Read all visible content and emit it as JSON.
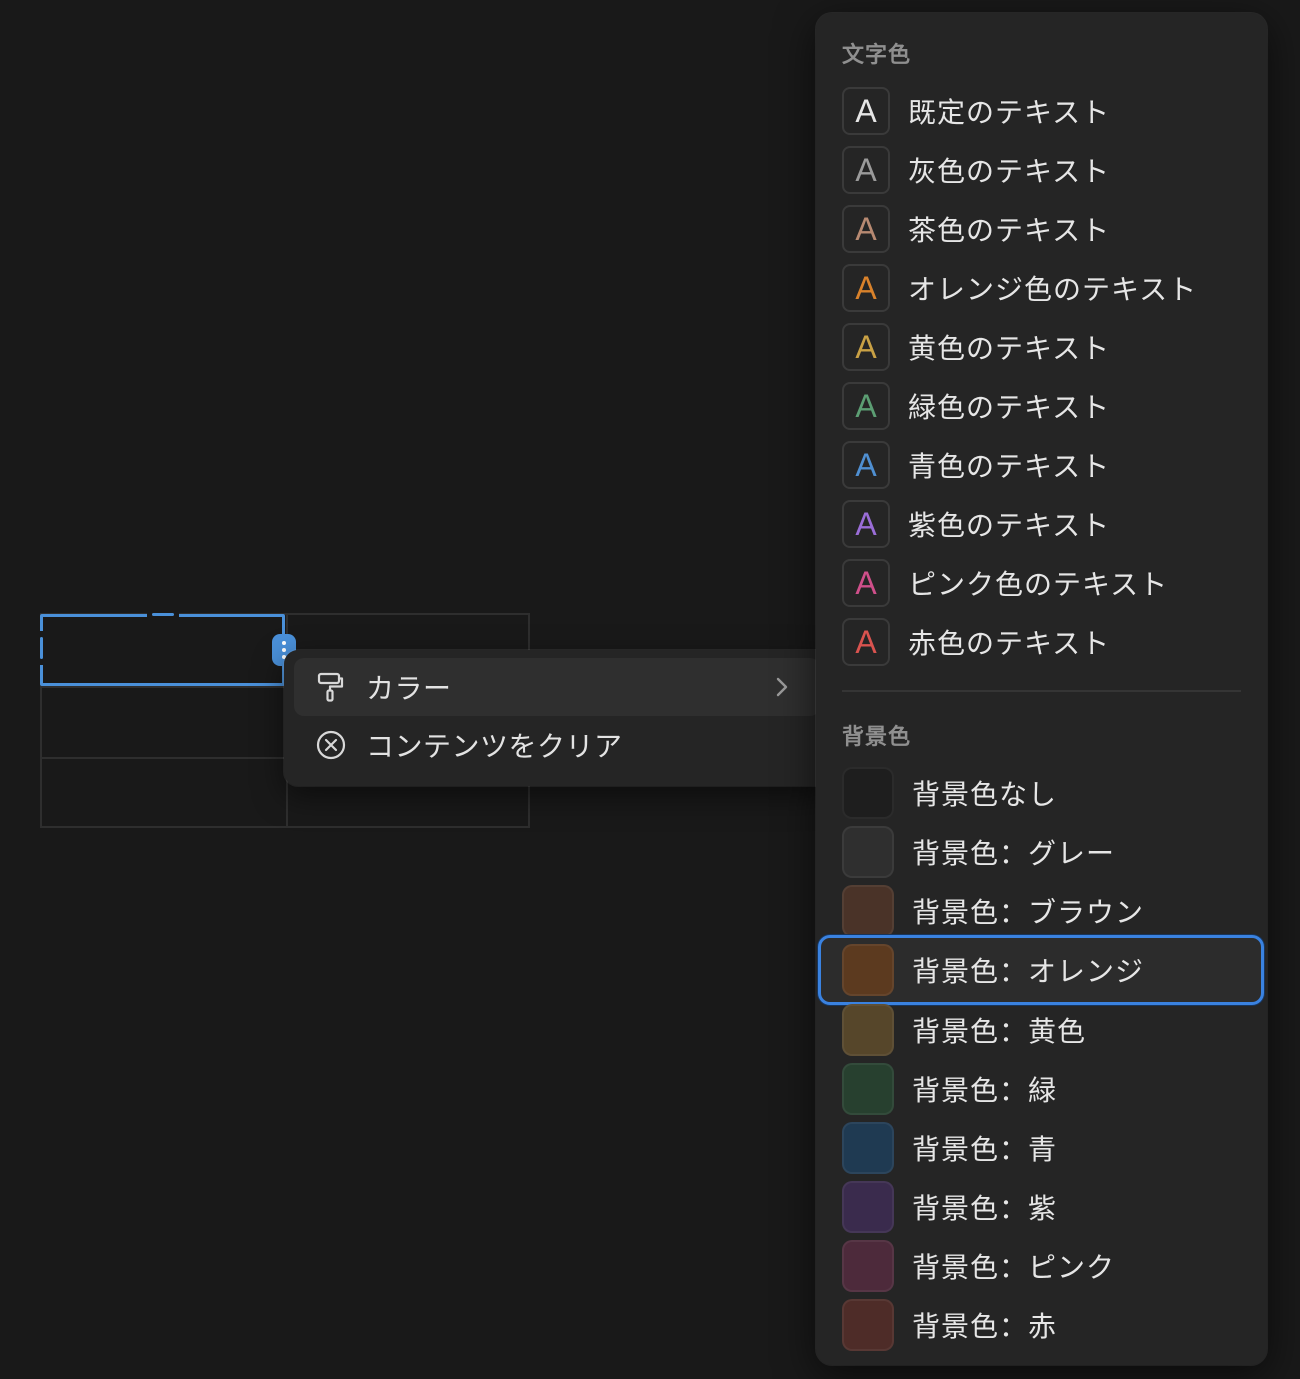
{
  "context_menu": {
    "items": [
      {
        "label": "カラー",
        "icon": "paint-roller-icon",
        "has_submenu": true
      },
      {
        "label": "コンテンツをクリア",
        "icon": "clear-circle-x-icon",
        "has_submenu": false
      }
    ]
  },
  "color_panel": {
    "text_section_title": "文字色",
    "text_colors": [
      {
        "letter": "A",
        "label": "既定のテキスト",
        "color": "#e6e6e6"
      },
      {
        "letter": "A",
        "label": "灰色のテキスト",
        "color": "#9b9b9b"
      },
      {
        "letter": "A",
        "label": "茶色のテキスト",
        "color": "#b88a72"
      },
      {
        "letter": "A",
        "label": "オレンジ色のテキスト",
        "color": "#d9822b"
      },
      {
        "letter": "A",
        "label": "黄色のテキスト",
        "color": "#c9a145"
      },
      {
        "letter": "A",
        "label": "緑色のテキスト",
        "color": "#5c9e73"
      },
      {
        "letter": "A",
        "label": "青色のテキスト",
        "color": "#4f8fd1"
      },
      {
        "letter": "A",
        "label": "紫色のテキスト",
        "color": "#9a6dd7"
      },
      {
        "letter": "A",
        "label": "ピンク色のテキスト",
        "color": "#cf4f8a"
      },
      {
        "letter": "A",
        "label": "赤色のテキスト",
        "color": "#d9534f"
      }
    ],
    "background_section_title": "背景色",
    "background_colors": [
      {
        "label": "背景色なし",
        "color": "#1e1e1e"
      },
      {
        "label": "背景色：グレー",
        "color": "#2f2f2f"
      },
      {
        "label": "背景色：ブラウン",
        "color": "#4a3328"
      },
      {
        "label": "背景色：オレンジ",
        "color": "#5c3a1f"
      },
      {
        "label": "背景色：黄色",
        "color": "#56462a"
      },
      {
        "label": "背景色：緑",
        "color": "#27402f"
      },
      {
        "label": "背景色：青",
        "color": "#1f3a52"
      },
      {
        "label": "背景色：紫",
        "color": "#3a2b4d"
      },
      {
        "label": "背景色：ピンク",
        "color": "#4d2a3b"
      },
      {
        "label": "背景色：赤",
        "color": "#4e2c28"
      }
    ],
    "selected_background_index": 3
  },
  "accent_color": "#4a90d9"
}
